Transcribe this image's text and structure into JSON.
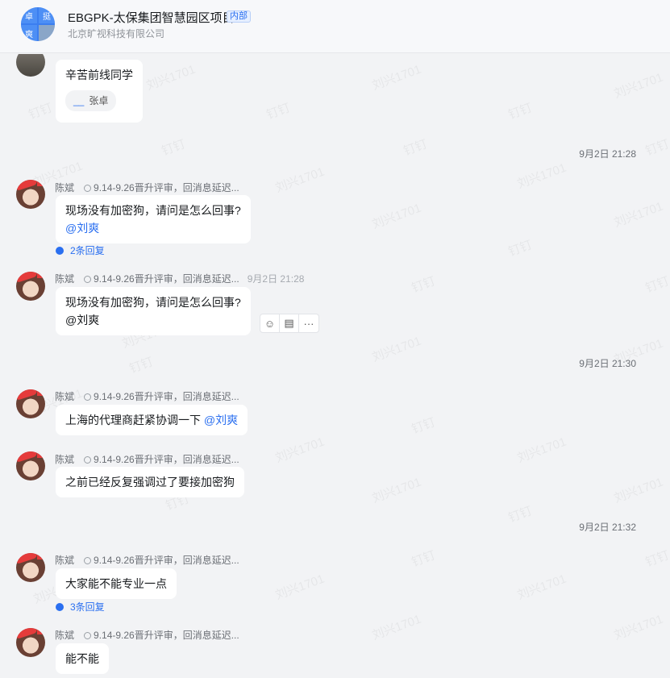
{
  "header": {
    "title": "EBGPK-太保集团智慧园区项目",
    "tag": "内部",
    "subtitle": "北京旷视科技有限公司",
    "avatar_chars": [
      "卓",
      "挺",
      "爽"
    ]
  },
  "watermark": {
    "name": "刘兴1701",
    "app": "钉钉"
  },
  "messages": [
    {
      "text": "辛苦前线同学",
      "reaction": "张卓"
    },
    {
      "time_sep": "9月2日 21:28"
    },
    {
      "sender": "陈斌",
      "signature": "9.14-9.26晋升评审，回消息延迟...",
      "text": "现场没有加密狗，请问是怎么回事?",
      "mention": "@刘爽",
      "replies": "2条回复"
    },
    {
      "sender": "陈斌",
      "signature": "9.14-9.26晋升评审，回消息延迟...",
      "time": "9月2日 21:28",
      "text": "现场没有加密狗，请问是怎么回事?",
      "mention": "@刘爽"
    },
    {
      "time_sep": "9月2日 21:30"
    },
    {
      "sender": "陈斌",
      "signature": "9.14-9.26晋升评审，回消息延迟...",
      "text": "上海的代理商赶紧协调一下",
      "mention": "@刘爽"
    },
    {
      "sender": "陈斌",
      "signature": "9.14-9.26晋升评审，回消息延迟...",
      "text": "之前已经反复强调过了要接加密狗"
    },
    {
      "time_sep": "9月2日 21:32"
    },
    {
      "sender": "陈斌",
      "signature": "9.14-9.26晋升评审，回消息延迟...",
      "text": "大家能不能专业一点",
      "replies": "3条回复"
    },
    {
      "sender": "陈斌",
      "signature": "9.14-9.26晋升评审，回消息延迟...",
      "text": "能不能"
    }
  ],
  "hover_actions": [
    "☺",
    "▤",
    "···"
  ]
}
